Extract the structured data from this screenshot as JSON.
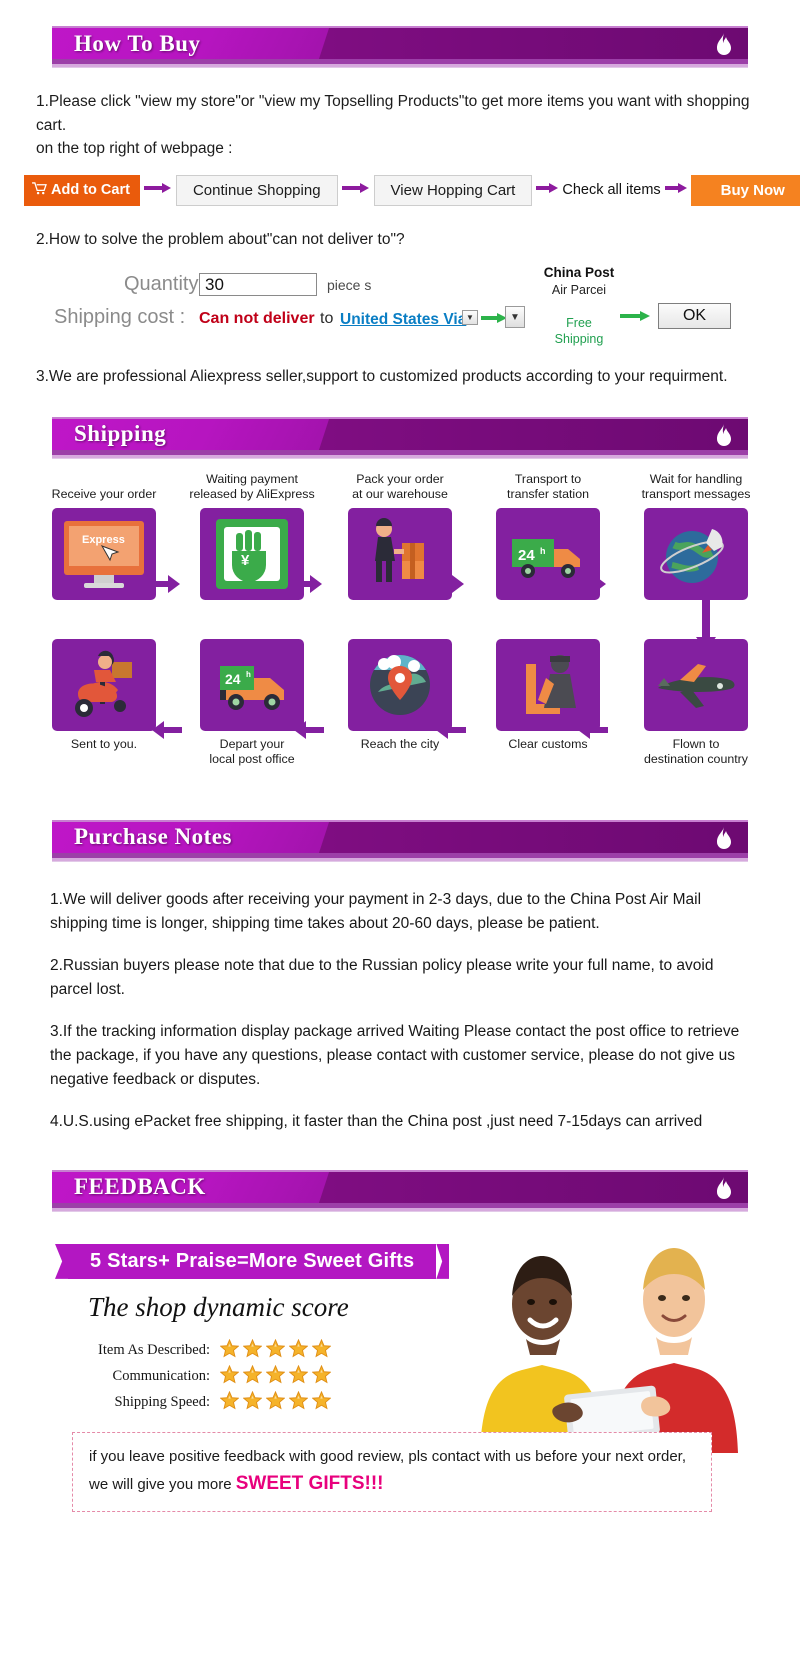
{
  "sections": {
    "how_to_buy": {
      "title": "How To Buy",
      "step1": "1.Please click \"view my store\"or \"view my Topselling Products\"to get more items you want with shopping cart.",
      "step1b": "on the top right of webpage :",
      "flow": [
        {
          "label": "Add to Cart",
          "style": "orange-red",
          "icon": "cart-icon"
        },
        {
          "label": "Continue Shopping",
          "style": "white"
        },
        {
          "label": "View Hopping Cart",
          "style": "white"
        },
        {
          "label": "Check all items",
          "style": "plain"
        },
        {
          "label": "Buy Now",
          "style": "orange"
        }
      ],
      "step2": "2.How to solve the problem about\"can not deliver to\"?",
      "quantity_label": "Quantity :",
      "quantity_value": "30",
      "piece_label": "piece s",
      "shipping_cost_label": "Shipping cost :",
      "cannot_deliver": "Can not deliver",
      "to_word": "to",
      "country": "United States Via",
      "carrier_name": "China Post",
      "carrier_sub": "Air Parcei",
      "free": "Free",
      "shipping_word": "Shipping",
      "ok_label": "OK",
      "step3": "3.We are professional Aliexpress seller,support to customized products according to your requirment."
    },
    "shipping": {
      "title": "Shipping",
      "steps_top": [
        {
          "caption": "Receive your order",
          "icon": "monitor-express-icon"
        },
        {
          "caption": "Waiting payment\nreleased by AliExpress",
          "icon": "hand-yuan-icon"
        },
        {
          "caption": "Pack your order\nat our warehouse",
          "icon": "worker-boxes-icon"
        },
        {
          "caption": "Transport to\ntransfer station",
          "icon": "truck-24h-icon"
        },
        {
          "caption": "Wait for handling\ntransport messages",
          "icon": "globe-rocket-icon"
        }
      ],
      "steps_bottom": [
        {
          "caption": "Sent to you.",
          "icon": "scooter-courier-icon"
        },
        {
          "caption": "Depart your\nlocal post office",
          "icon": "van-24h-icon"
        },
        {
          "caption": "Reach the city",
          "icon": "city-pin-icon"
        },
        {
          "caption": "Clear customs",
          "icon": "customs-officer-icon"
        },
        {
          "caption": "Flown to\ndestination country",
          "icon": "airplane-icon"
        }
      ]
    },
    "purchase_notes": {
      "title": "Purchase Notes",
      "notes": [
        "1.We will  deliver goods after receiving your payment in 2-3 days, due to the China Post Air Mail shipping time is longer, shipping time takes about 20-60 days, please be patient.",
        "2.Russian buyers please note that due to the Russian policy please write your full name, to avoid parcel lost.",
        "3.If the tracking information display package arrived Waiting Please contact the post office to retrieve the package, if you have any questions, please contact with customer service, please   do not give us negative feedback or disputes.",
        "4.U.S.using ePacket free shipping, it faster than the China post ,just need 7-15days can arrived"
      ]
    },
    "feedback": {
      "title": "FEEDBACK",
      "ribbon": "5 Stars+ Praise=More Sweet Gifts",
      "score_title": "The shop dynamic score",
      "scores": [
        {
          "label": "Item As Described:",
          "stars": 5
        },
        {
          "label": "Communication:",
          "stars": 5
        },
        {
          "label": "Shipping Speed:",
          "stars": 5
        }
      ],
      "promo_line1": "if you leave positive feedback with good review, pls contact with us before your next order,",
      "promo_line2_prefix": "we will give you more ",
      "promo_line2_highlight": "SWEET GIFTS!!!"
    }
  },
  "colors": {
    "banner_purple": "#7d0d80",
    "banner_light": "#b615c0",
    "orange": "#f58220",
    "orange_red": "#ea5b0c",
    "tile_purple": "#8320a0",
    "link_blue": "#0a7ec4",
    "error_red": "#c00018",
    "green": "#21a050",
    "star_gold": "#f2a71b",
    "pink": "#e8007d"
  }
}
